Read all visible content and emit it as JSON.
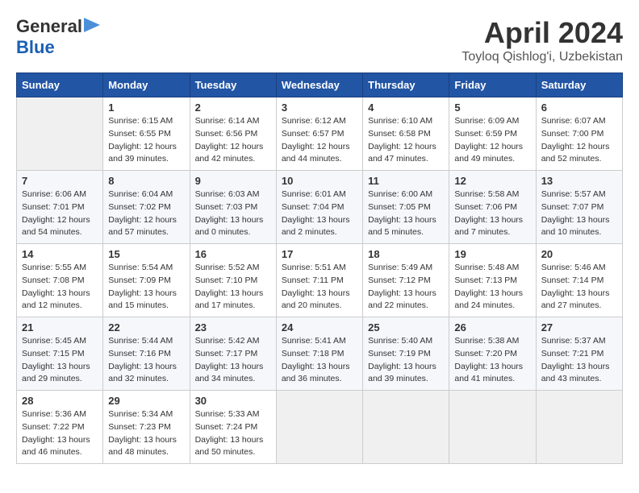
{
  "header": {
    "logo_general": "General",
    "logo_blue": "Blue",
    "month_title": "April 2024",
    "subtitle": "Toyloq Qishlog'i, Uzbekistan"
  },
  "calendar": {
    "days_of_week": [
      "Sunday",
      "Monday",
      "Tuesday",
      "Wednesday",
      "Thursday",
      "Friday",
      "Saturday"
    ],
    "weeks": [
      [
        {
          "day": "",
          "info": ""
        },
        {
          "day": "1",
          "info": "Sunrise: 6:15 AM\nSunset: 6:55 PM\nDaylight: 12 hours\nand 39 minutes."
        },
        {
          "day": "2",
          "info": "Sunrise: 6:14 AM\nSunset: 6:56 PM\nDaylight: 12 hours\nand 42 minutes."
        },
        {
          "day": "3",
          "info": "Sunrise: 6:12 AM\nSunset: 6:57 PM\nDaylight: 12 hours\nand 44 minutes."
        },
        {
          "day": "4",
          "info": "Sunrise: 6:10 AM\nSunset: 6:58 PM\nDaylight: 12 hours\nand 47 minutes."
        },
        {
          "day": "5",
          "info": "Sunrise: 6:09 AM\nSunset: 6:59 PM\nDaylight: 12 hours\nand 49 minutes."
        },
        {
          "day": "6",
          "info": "Sunrise: 6:07 AM\nSunset: 7:00 PM\nDaylight: 12 hours\nand 52 minutes."
        }
      ],
      [
        {
          "day": "7",
          "info": "Sunrise: 6:06 AM\nSunset: 7:01 PM\nDaylight: 12 hours\nand 54 minutes."
        },
        {
          "day": "8",
          "info": "Sunrise: 6:04 AM\nSunset: 7:02 PM\nDaylight: 12 hours\nand 57 minutes."
        },
        {
          "day": "9",
          "info": "Sunrise: 6:03 AM\nSunset: 7:03 PM\nDaylight: 13 hours\nand 0 minutes."
        },
        {
          "day": "10",
          "info": "Sunrise: 6:01 AM\nSunset: 7:04 PM\nDaylight: 13 hours\nand 2 minutes."
        },
        {
          "day": "11",
          "info": "Sunrise: 6:00 AM\nSunset: 7:05 PM\nDaylight: 13 hours\nand 5 minutes."
        },
        {
          "day": "12",
          "info": "Sunrise: 5:58 AM\nSunset: 7:06 PM\nDaylight: 13 hours\nand 7 minutes."
        },
        {
          "day": "13",
          "info": "Sunrise: 5:57 AM\nSunset: 7:07 PM\nDaylight: 13 hours\nand 10 minutes."
        }
      ],
      [
        {
          "day": "14",
          "info": "Sunrise: 5:55 AM\nSunset: 7:08 PM\nDaylight: 13 hours\nand 12 minutes."
        },
        {
          "day": "15",
          "info": "Sunrise: 5:54 AM\nSunset: 7:09 PM\nDaylight: 13 hours\nand 15 minutes."
        },
        {
          "day": "16",
          "info": "Sunrise: 5:52 AM\nSunset: 7:10 PM\nDaylight: 13 hours\nand 17 minutes."
        },
        {
          "day": "17",
          "info": "Sunrise: 5:51 AM\nSunset: 7:11 PM\nDaylight: 13 hours\nand 20 minutes."
        },
        {
          "day": "18",
          "info": "Sunrise: 5:49 AM\nSunset: 7:12 PM\nDaylight: 13 hours\nand 22 minutes."
        },
        {
          "day": "19",
          "info": "Sunrise: 5:48 AM\nSunset: 7:13 PM\nDaylight: 13 hours\nand 24 minutes."
        },
        {
          "day": "20",
          "info": "Sunrise: 5:46 AM\nSunset: 7:14 PM\nDaylight: 13 hours\nand 27 minutes."
        }
      ],
      [
        {
          "day": "21",
          "info": "Sunrise: 5:45 AM\nSunset: 7:15 PM\nDaylight: 13 hours\nand 29 minutes."
        },
        {
          "day": "22",
          "info": "Sunrise: 5:44 AM\nSunset: 7:16 PM\nDaylight: 13 hours\nand 32 minutes."
        },
        {
          "day": "23",
          "info": "Sunrise: 5:42 AM\nSunset: 7:17 PM\nDaylight: 13 hours\nand 34 minutes."
        },
        {
          "day": "24",
          "info": "Sunrise: 5:41 AM\nSunset: 7:18 PM\nDaylight: 13 hours\nand 36 minutes."
        },
        {
          "day": "25",
          "info": "Sunrise: 5:40 AM\nSunset: 7:19 PM\nDaylight: 13 hours\nand 39 minutes."
        },
        {
          "day": "26",
          "info": "Sunrise: 5:38 AM\nSunset: 7:20 PM\nDaylight: 13 hours\nand 41 minutes."
        },
        {
          "day": "27",
          "info": "Sunrise: 5:37 AM\nSunset: 7:21 PM\nDaylight: 13 hours\nand 43 minutes."
        }
      ],
      [
        {
          "day": "28",
          "info": "Sunrise: 5:36 AM\nSunset: 7:22 PM\nDaylight: 13 hours\nand 46 minutes."
        },
        {
          "day": "29",
          "info": "Sunrise: 5:34 AM\nSunset: 7:23 PM\nDaylight: 13 hours\nand 48 minutes."
        },
        {
          "day": "30",
          "info": "Sunrise: 5:33 AM\nSunset: 7:24 PM\nDaylight: 13 hours\nand 50 minutes."
        },
        {
          "day": "",
          "info": ""
        },
        {
          "day": "",
          "info": ""
        },
        {
          "day": "",
          "info": ""
        },
        {
          "day": "",
          "info": ""
        }
      ]
    ]
  }
}
